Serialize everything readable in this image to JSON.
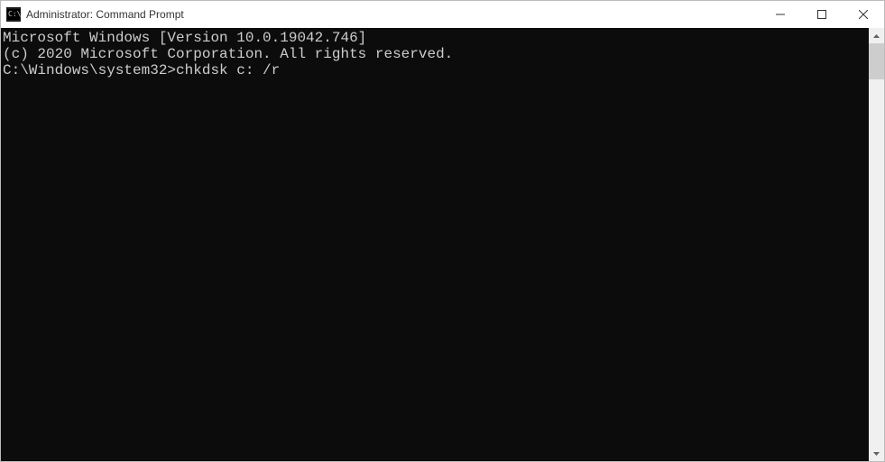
{
  "titlebar": {
    "title": "Administrator: Command Prompt"
  },
  "terminal": {
    "line1": "Microsoft Windows [Version 10.0.19042.746]",
    "line2": "(c) 2020 Microsoft Corporation. All rights reserved.",
    "blank": "",
    "prompt": "C:\\Windows\\system32>",
    "command": "chkdsk c: /r"
  }
}
